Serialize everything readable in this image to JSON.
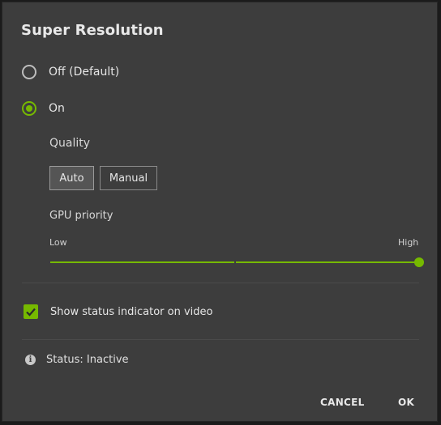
{
  "dialog": {
    "title": "Super Resolution"
  },
  "mode": {
    "options": [
      {
        "label": "Off (Default)",
        "selected": false
      },
      {
        "label": "On",
        "selected": true
      }
    ]
  },
  "quality": {
    "label": "Quality",
    "options": [
      {
        "label": "Auto",
        "selected": true
      },
      {
        "label": "Manual",
        "selected": false
      }
    ]
  },
  "gpu_priority": {
    "label": "GPU priority",
    "min_label": "Low",
    "max_label": "High",
    "value_fraction": 1.0
  },
  "status_indicator": {
    "label": "Show status indicator on video",
    "checked": true
  },
  "status": {
    "text": "Status: Inactive",
    "icon": "info-icon"
  },
  "actions": {
    "cancel_label": "CANCEL",
    "ok_label": "OK"
  },
  "colors": {
    "accent": "#76b900",
    "background": "#3d3d3d"
  }
}
